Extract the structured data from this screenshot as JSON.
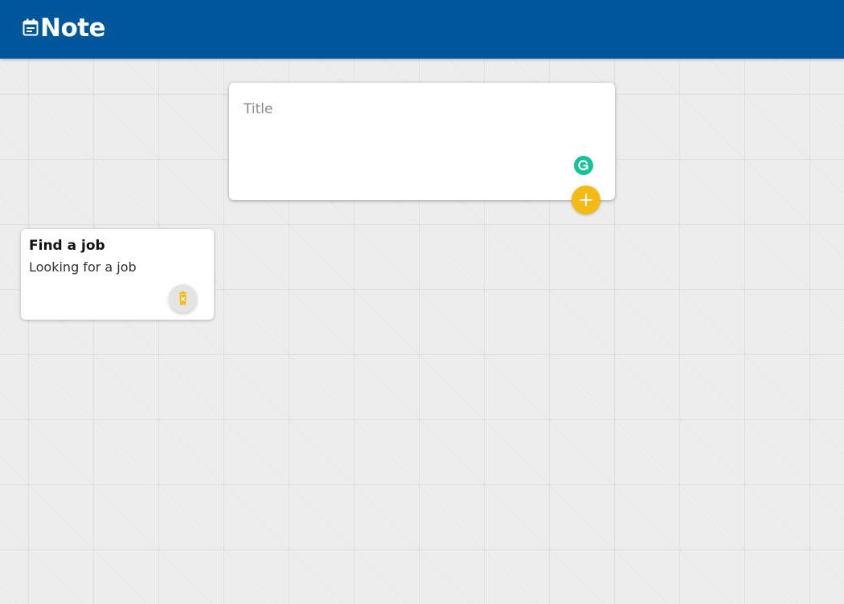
{
  "header": {
    "title": "Note",
    "logo_icon": "note-calendar-icon",
    "background": "#00569a"
  },
  "create_note": {
    "title_placeholder": "Title",
    "title_value": "",
    "add_button_icon": "plus-icon",
    "grammarly_icon": "grammarly-icon",
    "accent": "#f5ba13"
  },
  "notes": [
    {
      "title": "Find a job",
      "content": "Looking for a job",
      "delete_icon": "trash-icon"
    }
  ]
}
